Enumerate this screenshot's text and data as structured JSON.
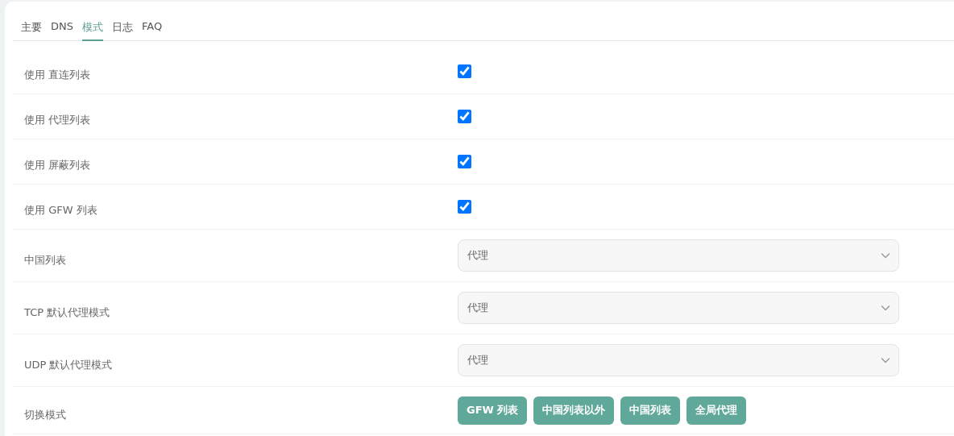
{
  "tabs": [
    {
      "label": "主要",
      "selected": false
    },
    {
      "label": "DNS",
      "selected": false
    },
    {
      "label": "模式",
      "selected": true
    },
    {
      "label": "日志",
      "selected": false
    },
    {
      "label": "FAQ",
      "selected": false
    }
  ],
  "rows": [
    {
      "kind": "checkbox",
      "label": "使用 直连列表",
      "checked": true
    },
    {
      "kind": "checkbox",
      "label": "使用 代理列表",
      "checked": true
    },
    {
      "kind": "checkbox",
      "label": "使用 屏蔽列表",
      "checked": true
    },
    {
      "kind": "checkbox",
      "label": "使用 GFW 列表",
      "checked": true
    },
    {
      "kind": "select",
      "label": "中国列表",
      "value": "代理"
    },
    {
      "kind": "select",
      "label": "TCP 默认代理模式",
      "value": "代理"
    },
    {
      "kind": "select",
      "label": "UDP 默认代理模式",
      "value": "代理"
    },
    {
      "kind": "buttons",
      "label": "切换模式",
      "buttons": [
        "GFW 列表",
        "中国列表以外",
        "中国列表",
        "全局代理"
      ]
    }
  ]
}
